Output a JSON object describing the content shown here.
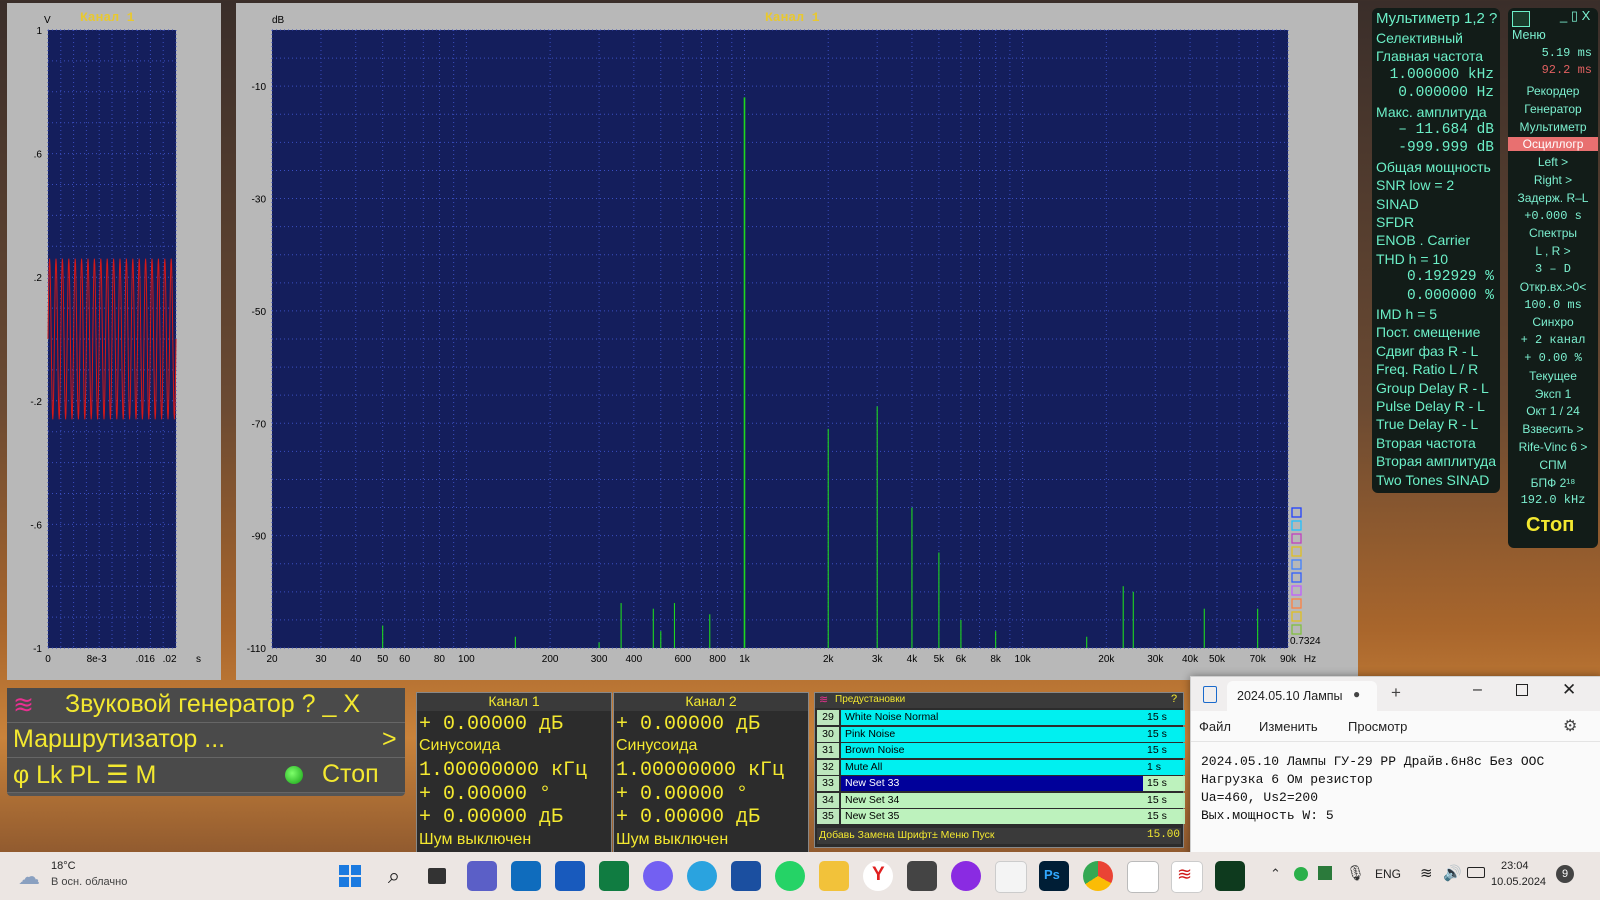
{
  "colors": {
    "plot_bg": "#141e5c",
    "grid": "#3a4ec0",
    "spectrum_line": "#1ed81e",
    "osc_trace": "#d41818",
    "yellow": "#f3e830",
    "cyan_text": "#6cf0c8"
  },
  "osc": {
    "title": "Канал 1",
    "y_unit": "V",
    "x_unit": "s",
    "y_ticks": [
      "1",
      ".6",
      ".2",
      "-.2",
      "-.6",
      "-1"
    ],
    "x_ticks": [
      "0",
      "8e-3",
      ".016",
      ".02"
    ]
  },
  "spectrum": {
    "title": "Канал 1",
    "y_unit": "dB",
    "x_unit": "Hz",
    "y_ticks": [
      "-10",
      "-30",
      "-50",
      "-70",
      "-90",
      "-110"
    ],
    "x_ticks": [
      "20",
      "30",
      "40",
      "50",
      "60",
      "80",
      "100",
      "200",
      "300",
      "400",
      "600",
      "800",
      "1k",
      "2k",
      "3k",
      "4k",
      "5k",
      "6k",
      "8k",
      "10k",
      "20k",
      "30k",
      "40k",
      "50k",
      "70k",
      "90k"
    ],
    "corner_value": "0.7324"
  },
  "chart_data": {
    "type": "line",
    "title": "Канал 1",
    "ylabel": "dB",
    "xlabel": "Hz",
    "x_scale": "log",
    "xlim": [
      20,
      90000
    ],
    "ylim": [
      -110,
      0
    ],
    "grid": true,
    "peaks": [
      {
        "x": 50,
        "y": -106
      },
      {
        "x": 150,
        "y": -108
      },
      {
        "x": 300,
        "y": -109
      },
      {
        "x": 360,
        "y": -102
      },
      {
        "x": 470,
        "y": -103
      },
      {
        "x": 500,
        "y": -107
      },
      {
        "x": 560,
        "y": -102
      },
      {
        "x": 750,
        "y": -104
      },
      {
        "x": 1000,
        "y": -12
      },
      {
        "x": 2000,
        "y": -71
      },
      {
        "x": 3000,
        "y": -67
      },
      {
        "x": 4000,
        "y": -85
      },
      {
        "x": 5000,
        "y": -93
      },
      {
        "x": 6000,
        "y": -105
      },
      {
        "x": 8000,
        "y": -107
      },
      {
        "x": 17000,
        "y": -108
      },
      {
        "x": 23000,
        "y": -99
      },
      {
        "x": 25000,
        "y": -100
      },
      {
        "x": 45000,
        "y": -103
      },
      {
        "x": 70000,
        "y": -103
      }
    ]
  },
  "multimeter": {
    "title": "Мультиметр 1,2 ?",
    "rows": [
      "Селективный",
      "Главная частота",
      "1.000000 kHz",
      "0.000000  Hz",
      "Макс. амплитуда",
      "– 11.684 dB",
      "-999.999 dB",
      "Общая мощность",
      "SNR       low =  2",
      "SINAD",
      "SFDR",
      "ENOB . Carrier",
      "THD        h = 10",
      "0.192929 %",
      "0.000000 %",
      "IMD        h =  5",
      "Пост. смещение",
      "Сдвиг фаз R - L",
      "Freq. Ratio  L / R",
      "Group Delay R - L",
      "Pulse Delay R - L",
      "True Delay R - L",
      "Вторая частота",
      "Вторая амплитуда",
      "Two Tones SINAD"
    ]
  },
  "menu": {
    "top": "Меню",
    "time1": "5.19 ms",
    "time2": "92.2 ms",
    "items": [
      "Рекордер",
      "Генератор",
      "Мультиметр",
      "Осциллогр",
      "Left      >",
      "Right     >",
      "Задерж. R–L",
      "+0.000  s",
      "Спектры",
      "L , R     >",
      "3 – D",
      "Откр.вх.>0<",
      "100.0 ms",
      "Синхро",
      "+ 2 канал",
      "+ 0.00 %",
      "Текущее",
      "Эксп      1",
      "Окт  1 / 24",
      "Взвесить  >",
      "Rife-Vinc 6 >",
      "СПМ",
      "БПФ   2¹⁸",
      "192.0 kHz"
    ],
    "stop": "Стоп"
  },
  "generator": {
    "title": "Звуковой генератор  ?  _  X",
    "router": "Маршрутизатор ...",
    "arrow": ">",
    "bottom": "φ Lk PL ☰ M",
    "stop": "Стоп"
  },
  "channels": [
    {
      "name": "Канал 1",
      "level": "+    0.00000 дБ",
      "wave": "Синусоида",
      "freq": "1.00000000 кГц",
      "phase": "+    0.00000 °",
      "level2": "+    0.00000 дБ",
      "noise": "Шум выключен"
    },
    {
      "name": "Канал 2",
      "level": "+    0.00000 дБ",
      "wave": "Синусоида",
      "freq": "1.00000000 кГц",
      "phase": "+    0.00000 °",
      "level2": "+    0.00000 дБ",
      "noise": "Шум выключен"
    }
  ],
  "presets": {
    "title": "Предустановки",
    "rows": [
      {
        "n": "29",
        "name": "White Noise Normal",
        "t": "15 s"
      },
      {
        "n": "30",
        "name": "Pink Noise",
        "t": "15 s"
      },
      {
        "n": "31",
        "name": "Brown Noise",
        "t": "15 s"
      },
      {
        "n": "32",
        "name": "Mute All",
        "t": "1 s"
      },
      {
        "n": "33",
        "name": "New Set 33",
        "t": "15 s"
      },
      {
        "n": "34",
        "name": "New Set 34",
        "t": "15 s"
      },
      {
        "n": "35",
        "name": "New Set 35",
        "t": "15 s"
      }
    ],
    "footer": "Добавь Замена Шрифт± Меню Пуск",
    "footer_val": "15.00"
  },
  "notepad": {
    "tab": "2024.05.10 Лампы",
    "menu": [
      "Файл",
      "Изменить",
      "Просмотр"
    ],
    "lines": [
      "2024.05.10 Лампы ГУ-29 РР Драйв.6н8с Без ООС",
      "Нагрузка 6 Ом резистор",
      "Ua=460, Us2=200",
      "Вых.мощность W: 5"
    ]
  },
  "taskbar": {
    "temp": "18°C",
    "weather": "В осн. облачно",
    "lang": "ENG",
    "time": "23:04",
    "date": "10.05.2024",
    "badge": "9"
  }
}
